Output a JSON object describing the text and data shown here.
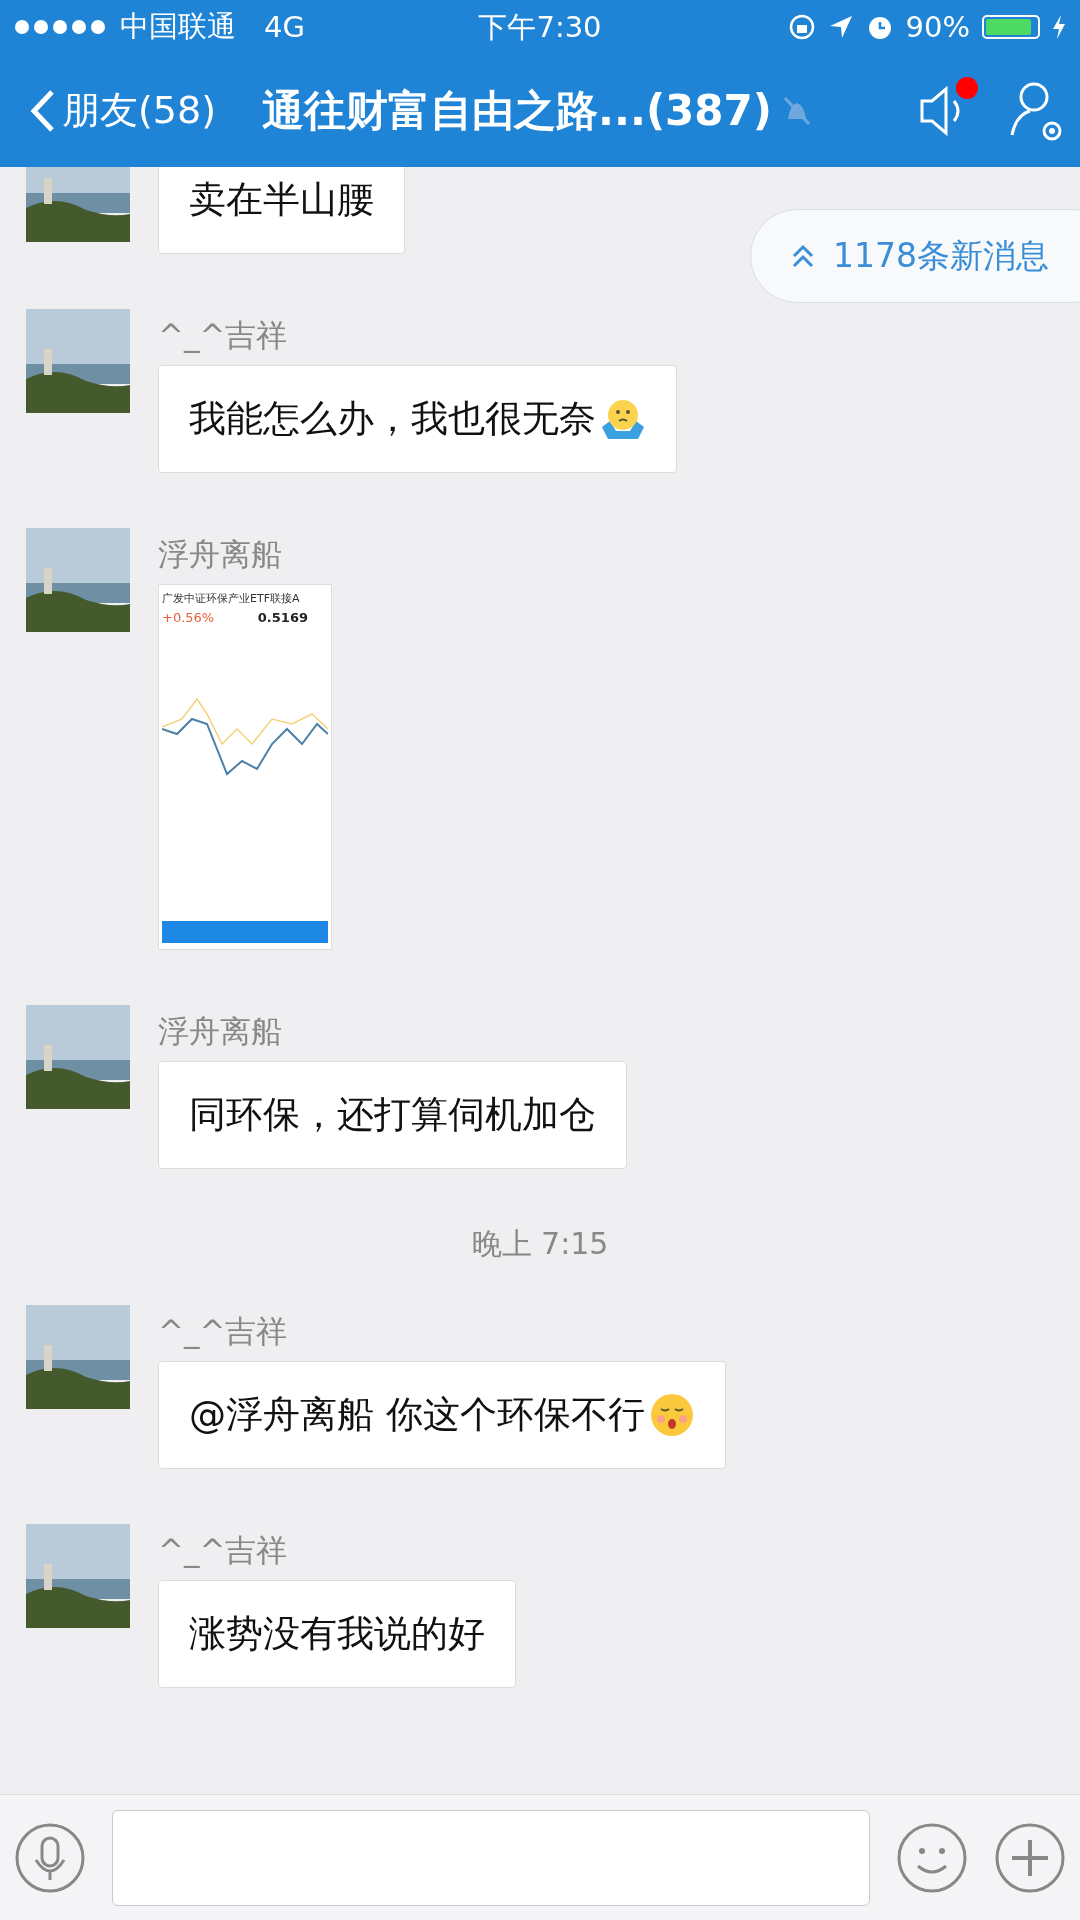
{
  "status_bar": {
    "carrier": "中国联通",
    "network": "4G",
    "time": "下午7:30",
    "battery": "90%",
    "level": 0.9
  },
  "nav": {
    "back_label": "朋友(58)",
    "title": "通往财富自由之路...(387)",
    "muted": true,
    "speaker_badge": true
  },
  "new_messages": {
    "label": "1178条新消息"
  },
  "messages": [
    {
      "kind": "text",
      "text": "卖在半山腰"
    },
    {
      "kind": "text",
      "sender": "^_^吉祥",
      "text": "我能怎么办，我也很无奈",
      "emoji": {
        "kind": "shrug"
      }
    },
    {
      "kind": "image",
      "sender": "浮舟离船",
      "image": {
        "title": "广发中证环保产业ETF联接A",
        "change": "+0.56%",
        "nav": "0.5169"
      }
    },
    {
      "kind": "text",
      "sender": "浮舟离船",
      "text": "同环保，还打算伺机加仓"
    },
    {
      "kind": "time",
      "text": "晚上 7:15"
    },
    {
      "kind": "text",
      "sender": "^_^吉祥",
      "text": "@浮舟离船 你这个环保不行",
      "emoji": {
        "kind": "shush"
      }
    },
    {
      "kind": "text",
      "sender": "^_^吉祥",
      "text": "涨势没有我说的好"
    }
  ]
}
